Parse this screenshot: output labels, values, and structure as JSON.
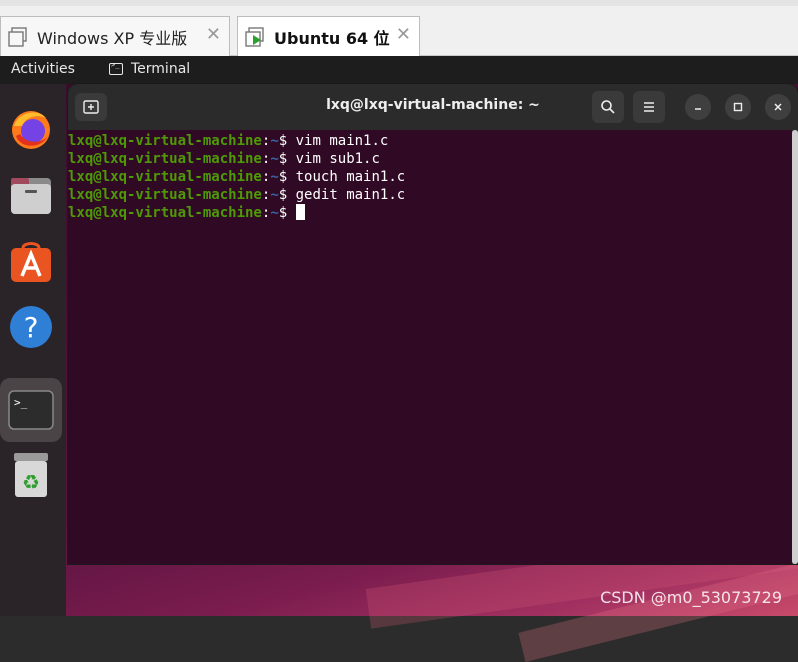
{
  "vm_tabs": [
    {
      "label": "Windows XP 专业版",
      "close": "✕"
    },
    {
      "label": "Ubuntu 64 位",
      "close": "✕",
      "active": true
    }
  ],
  "topbar": {
    "activities": "Activities",
    "app_name": "Terminal"
  },
  "dock": {
    "items": [
      "firefox-icon",
      "files-icon",
      "app-center-icon",
      "help-icon",
      "terminal-icon",
      "trash-icon"
    ],
    "running_accent": "#e95420"
  },
  "terminal": {
    "title": "lxq@lxq-virtual-machine: ~",
    "prompt": {
      "user_host": "lxq@lxq-virtual-machine",
      "colon": ":",
      "path": "~",
      "dollar": "$"
    },
    "commands": [
      " vim main1.c",
      " vim sub1.c",
      " touch main1.c",
      " gedit main1.c",
      " "
    ],
    "colors": {
      "background": "#300a24",
      "user": "#4e9a06",
      "path": "#3465a4",
      "header": "#2b2b2b"
    }
  },
  "watermark": "CSDN @m0_53073729"
}
